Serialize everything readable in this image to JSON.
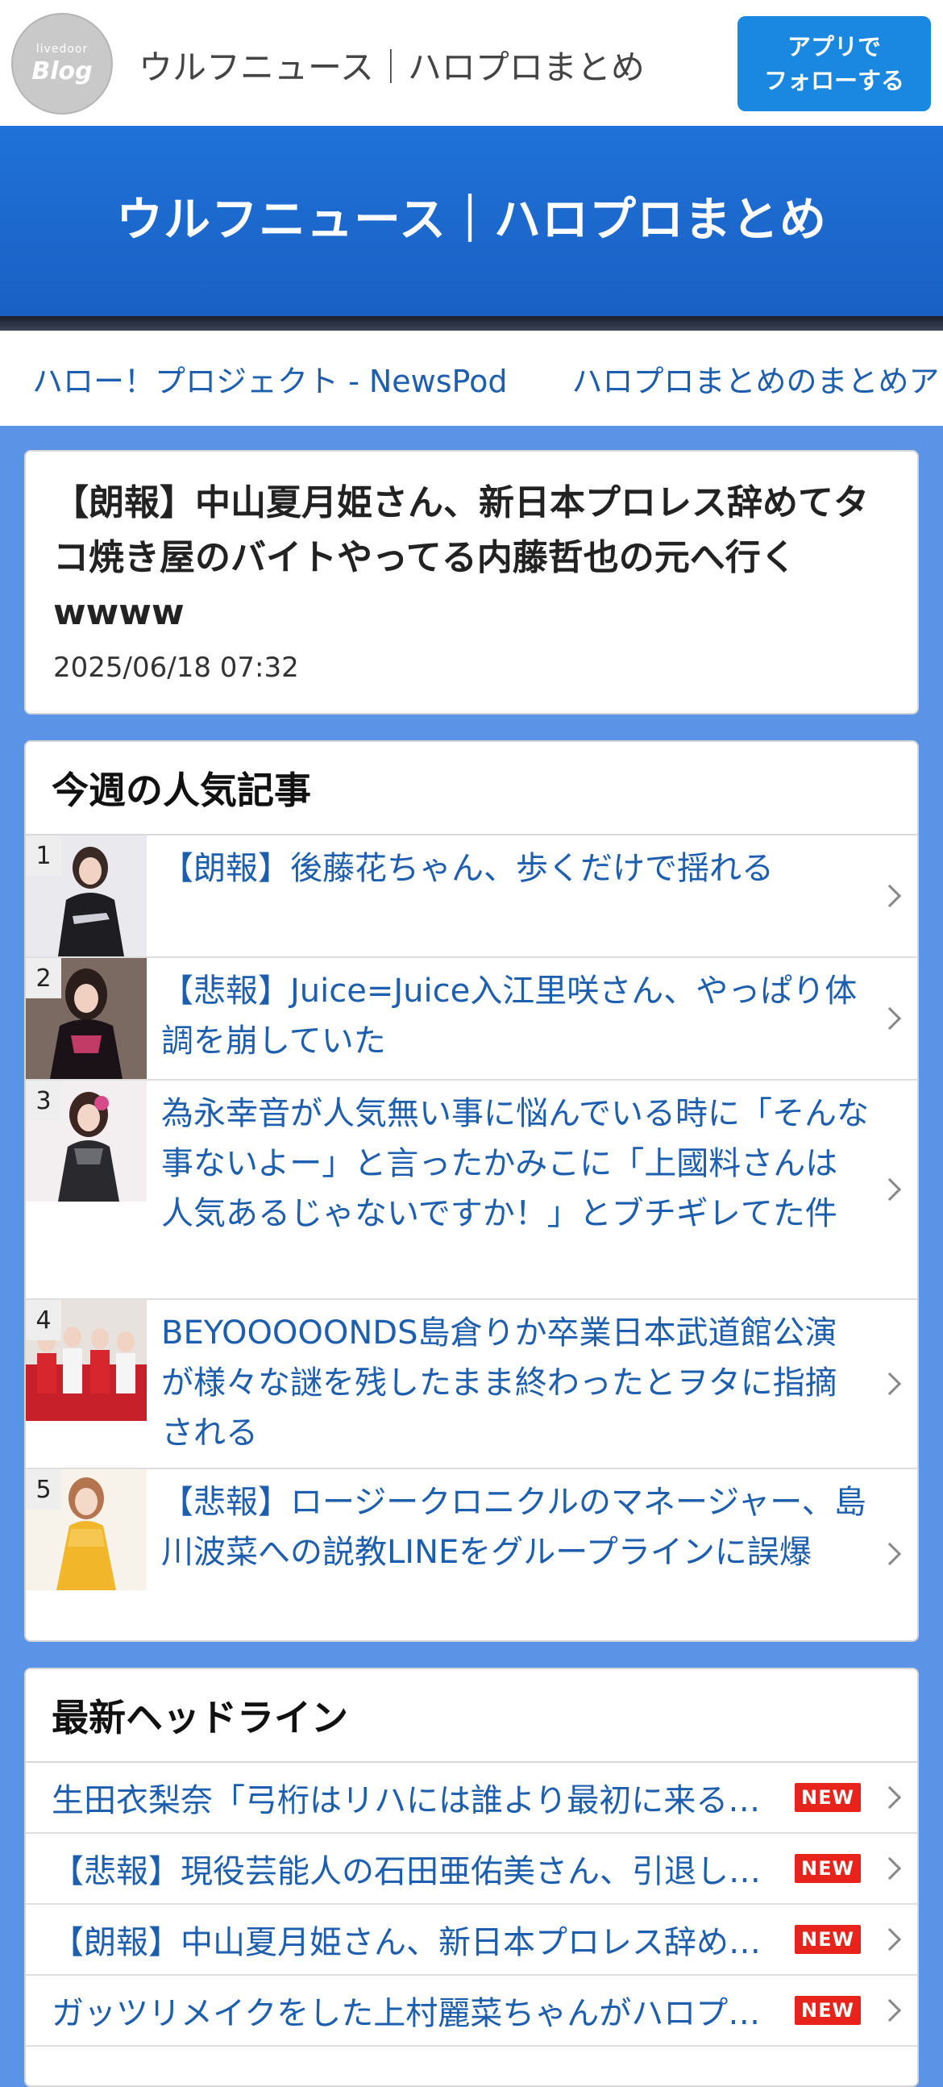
{
  "topbar": {
    "logo_small": "livedoor",
    "logo_big": "Blog",
    "title": "ウルフニュース｜ハロプロまとめ",
    "follow_line1": "アプリで",
    "follow_line2": "フォローする"
  },
  "hero": {
    "title": "ウルフニュース｜ハロプロまとめ"
  },
  "nav": {
    "items": [
      {
        "label": "ハロー！プロジェクト - NewsPod"
      },
      {
        "label": "ハロプロまとめのまとめア"
      }
    ]
  },
  "article": {
    "title": "【朗報】中山夏月姫さん、新日本プロレス辞めてタコ焼き屋のバイトやってる内藤哲也の元へ行くwwww",
    "date": "2025/06/18 07:32"
  },
  "ranking": {
    "title": "今週の人気記事",
    "items": [
      {
        "rank": "1",
        "text": "【朗報】後藤花ちゃん、歩くだけで揺れる"
      },
      {
        "rank": "2",
        "text": "【悲報】Juice=Juice入江里咲さん、やっぱり体調を崩していた"
      },
      {
        "rank": "3",
        "text": "為永幸音が人気無い事に悩んでいる時に「そんな事ないよー」と言ったかみこに「上國料さんは人気あるじゃないですか！」とブチギレてた件"
      },
      {
        "rank": "4",
        "text": "BEYOOOOONDS島倉りか卒業日本武道館公演が様々な謎を残したまま終わったとヲタに指摘される"
      },
      {
        "rank": "5",
        "text": "【悲報】ロージークロニクルのマネージャー、島川波菜への説教LINEをグループラインに誤爆"
      }
    ]
  },
  "headlines": {
    "title": "最新ヘッドライン",
    "badge": "NEW",
    "items": [
      {
        "text": "生田衣梨奈「弓桁はリハには誰より最初に来る…"
      },
      {
        "text": "【悲報】現役芸能人の石田亜佑美さん、引退し…"
      },
      {
        "text": "【朗報】中山夏月姫さん、新日本プロレス辞め…"
      },
      {
        "text": "ガッツリメイクをした上村麗菜ちゃんがハロプ…"
      }
    ]
  },
  "colors": {
    "page_bg": "#5b93e6",
    "hero_bg": "#1f72d8",
    "follow_btn": "#1a87e0",
    "link": "#1d5fae",
    "new_badge": "#e8231c"
  }
}
